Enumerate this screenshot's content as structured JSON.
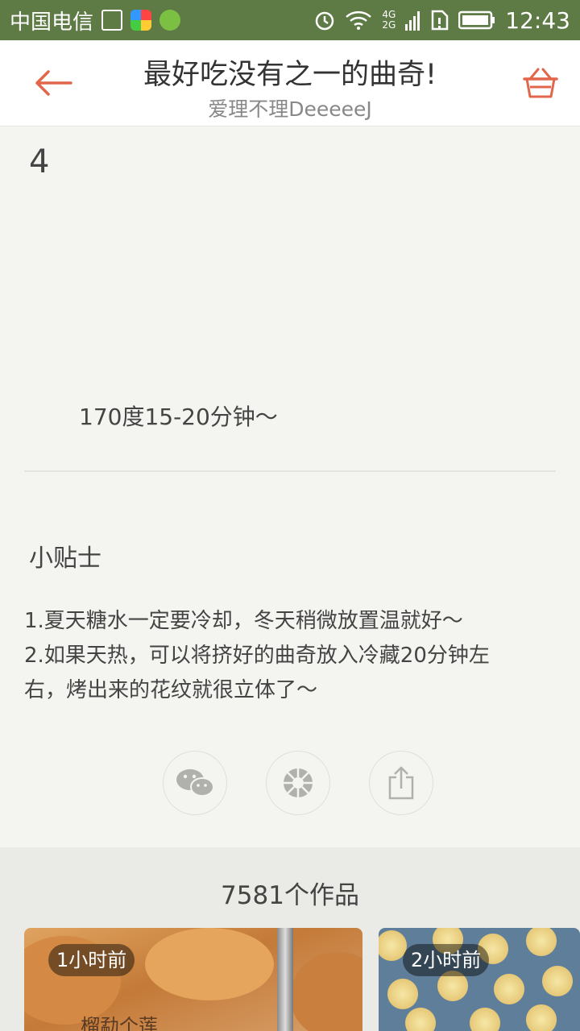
{
  "status_bar": {
    "carrier": "中国电信",
    "network": "4G",
    "network2": "2G",
    "time": "12:43",
    "icons": [
      "image-icon",
      "app-icon",
      "wechat-notification-icon",
      "alarm-icon",
      "wifi-icon",
      "signal-icon",
      "sim-icon",
      "battery-icon"
    ]
  },
  "header": {
    "title": "最好吃没有之一的曲奇!",
    "author": "爱理不理DeeeeeJ",
    "back_icon": "back-arrow-icon",
    "cart_icon": "basket-icon",
    "accent_color": "#e2664c"
  },
  "step": {
    "number": "4",
    "text": "170度15-20分钟～"
  },
  "tips": {
    "title": "小贴士",
    "line1": "1.夏天糖水一定要冷却，冬天稍微放置温就好～",
    "line2": "2.如果天热，可以将挤好的曲奇放入冷藏20分钟左",
    "line3": "右，烤出来的花纹就很立体了～"
  },
  "share": {
    "icons": [
      "wechat-icon",
      "moments-icon",
      "share-icon"
    ]
  },
  "works": {
    "title": "7581个作品",
    "cards": [
      {
        "badge": "1小时前",
        "caption": "榴勐个莲"
      },
      {
        "badge": "2小时前"
      }
    ]
  }
}
